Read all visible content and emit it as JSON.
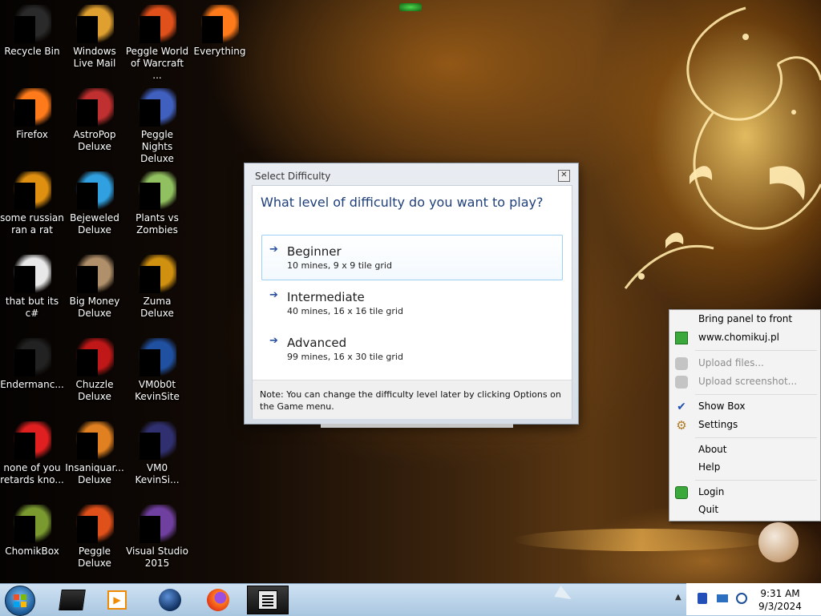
{
  "desktop_icons": [
    {
      "label": "Recycle Bin",
      "icon": "recycle-bin-icon"
    },
    {
      "label": "Windows Live Mail",
      "icon": "mail-icon"
    },
    {
      "label": "Peggle World of Warcraft ...",
      "icon": "peggle-icon"
    },
    {
      "label": "Everything",
      "icon": "search-icon"
    },
    {
      "label": "Firefox",
      "icon": "firefox-icon"
    },
    {
      "label": "AstroPop Deluxe",
      "icon": "astropop-icon"
    },
    {
      "label": "Peggle Nights Deluxe",
      "icon": "peggle-nights-icon"
    },
    {
      "label": "some russian ran a rat",
      "icon": "shortcut-icon"
    },
    {
      "label": "Bejeweled Deluxe",
      "icon": "gem-icon"
    },
    {
      "label": "Plants vs Zombies",
      "icon": "plant-icon"
    },
    {
      "label": "that but its c#",
      "icon": "shortcut-icon"
    },
    {
      "label": "Big Money Deluxe",
      "icon": "money-icon"
    },
    {
      "label": "Zuma Deluxe",
      "icon": "zuma-icon"
    },
    {
      "label": "Endermanc...",
      "icon": "app-icon"
    },
    {
      "label": "Chuzzle Deluxe",
      "icon": "chuzzle-icon"
    },
    {
      "label": "VM0b0t KevinSite",
      "icon": "vscode-icon"
    },
    {
      "label": "none of you retards kno...",
      "icon": "app-icon"
    },
    {
      "label": "Insaniquar... Deluxe",
      "icon": "fish-icon"
    },
    {
      "label": "VM0 KevinSi...",
      "icon": "file-icon"
    },
    {
      "label": "ChomikBox",
      "icon": "chomikbox-icon"
    },
    {
      "label": "Peggle Deluxe",
      "icon": "peggle-icon"
    },
    {
      "label": "Visual Studio 2015",
      "icon": "visual-studio-icon"
    }
  ],
  "dialog": {
    "title": "Select Difficulty",
    "heading": "What level of difficulty do you want to play?",
    "options": [
      {
        "title": "Beginner",
        "desc": "10 mines, 9 x 9 tile grid"
      },
      {
        "title": "Intermediate",
        "desc": "40 mines, 16 x 16 tile grid"
      },
      {
        "title": "Advanced",
        "desc": "99 mines, 16 x 30 tile grid"
      }
    ],
    "selected_option": "Beginner",
    "note": "Note: You can change the difficulty level later by clicking Options on the Game menu."
  },
  "context_menu": {
    "items": [
      {
        "label": "Bring panel to front",
        "icon": "",
        "enabled": true
      },
      {
        "label": "www.chomikuj.pl",
        "icon": "home-icon",
        "enabled": true
      },
      {
        "label": "Upload files...",
        "icon": "upload-icon",
        "enabled": false
      },
      {
        "label": "Upload screenshot...",
        "icon": "screenshot-icon",
        "enabled": false
      },
      {
        "label": "Show Box",
        "icon": "check-icon",
        "enabled": true,
        "checked": true
      },
      {
        "label": "Settings",
        "icon": "gear-icon",
        "enabled": true
      },
      {
        "label": "About",
        "icon": "",
        "enabled": true
      },
      {
        "label": "Help",
        "icon": "",
        "enabled": true
      },
      {
        "label": "Login",
        "icon": "power-icon",
        "enabled": true
      },
      {
        "label": "Quit",
        "icon": "",
        "enabled": true
      }
    ]
  },
  "taskbar": {
    "start_icon": "windows-start-icon",
    "pinned": [
      "terminal-icon",
      "media-player-icon",
      "globe-icon",
      "firefox-icon",
      "minesweeper-icon"
    ],
    "active": "minesweeper-icon",
    "clock_time": "9:31 AM",
    "clock_date": "9/3/2024",
    "tray_icons": [
      "chomikbox-tray-icon",
      "network-icon",
      "volume-icon"
    ]
  },
  "colors": {
    "dialog_heading": "#1f3f7a",
    "selection_border": "#9fd0f3",
    "taskbar": "#bcd4ea"
  }
}
